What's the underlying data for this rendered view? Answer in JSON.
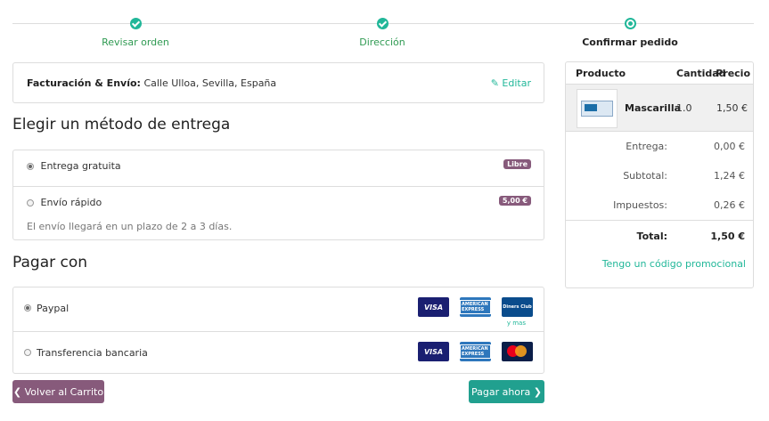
{
  "steps": [
    {
      "label": "Revisar orden"
    },
    {
      "label": "Dirección"
    },
    {
      "label": "Confirmar pedido"
    }
  ],
  "billing": {
    "label": "Facturación & Envío:",
    "address": "Calle Ulloa, Sevilla, España",
    "edit_label": "Editar"
  },
  "delivery": {
    "title": "Elegir un método de entrega",
    "options": [
      {
        "label": "Entrega gratuita",
        "badge": "Libre"
      },
      {
        "label": "Envío rápido",
        "badge": "5,00 €",
        "note": "El envío llegará en un plazo de 2 a 3 días."
      }
    ]
  },
  "payment": {
    "title": "Pagar con",
    "options": [
      {
        "label": "Paypal",
        "more": "y mas"
      },
      {
        "label": "Transferencia bancaria"
      }
    ],
    "card_labels": {
      "visa": "VISA",
      "amex": "AMERICAN EXPRESS",
      "diners": "Diners Club"
    }
  },
  "buttons": {
    "back": "❮ Volver al Carrito",
    "pay": "Pagar ahora ❯"
  },
  "summary": {
    "headers": {
      "product": "Producto",
      "qty": "Cantidad",
      "price": "Precio"
    },
    "item": {
      "name": "Mascarilla",
      "qty": "1.0",
      "price": "1,50 €"
    },
    "lines": [
      {
        "label": "Entrega:",
        "value": "0,00 €"
      },
      {
        "label": "Subtotal:",
        "value": "1,24 €"
      },
      {
        "label": "Impuestos:",
        "value": "0,26 €"
      }
    ],
    "total": {
      "label": "Total:",
      "value": "1,50 €"
    },
    "promo": "Tengo un código promocional"
  },
  "colors": {
    "accent": "#21b799",
    "brand": "#875a7b"
  }
}
